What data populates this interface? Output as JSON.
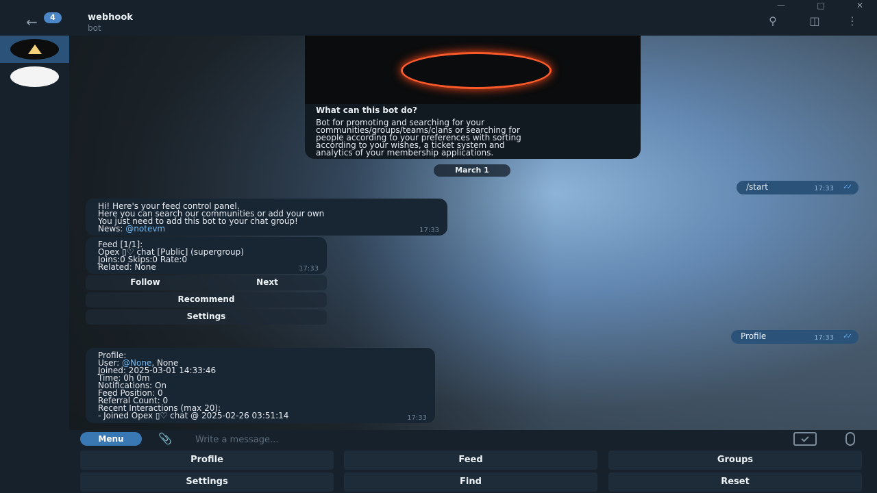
{
  "header": {
    "unread_badge": "4",
    "title": "webhook",
    "subtitle": "bot",
    "icons": [
      "back-arrow-icon",
      "search-icon",
      "sidebar-toggle-icon",
      "more-vertical-icon"
    ]
  },
  "bot_info": {
    "heading": "What can this bot do?",
    "description_lines": [
      "Bot for promoting and searching for your",
      "communities/groups/teams/clans or searching for",
      "people according to your preferences with sorting",
      "according to your wishes, a ticket system and",
      "analytics of your membership applications."
    ]
  },
  "date_separator": "March 1",
  "messages": {
    "start": {
      "text": "/start",
      "time": "17:33"
    },
    "welcome": {
      "lines": [
        "Hi! Here's your feed control panel.",
        "Here you can search our communities or add your own",
        "You just need to add this bot to your chat group!"
      ],
      "news_prefix": "News: ",
      "news_link": "@notevm",
      "time": "17:33"
    },
    "feed": {
      "lines": [
        "Feed [1/1]:",
        "Opex ▯♡ chat [Public] (supergroup)",
        "Joins:0 Skips:0 Rate:0",
        "Related: None"
      ],
      "time": "17:33",
      "buttons": {
        "follow": "Follow",
        "next": "Next",
        "recommend": "Recommend",
        "settings": "Settings"
      }
    },
    "profile_cmd": {
      "text": "Profile",
      "time": "17:33"
    },
    "profile": {
      "line1": "Profile:",
      "user_prefix": "User: ",
      "user_link": "@None",
      "user_suffix": ", None",
      "lines": [
        "Joined: 2025-03-01 14:33:46",
        "Time: 0h 0m",
        "Notifications: On",
        "Feed Position: 0",
        "Referral Count: 0",
        "Recent Interactions (max 20):",
        "- Joined Opex ▯♡ chat @ 2025-02-26 03:51:14"
      ],
      "time": "17:33"
    }
  },
  "composer": {
    "menu_label": "Menu",
    "placeholder": "Write a message..."
  },
  "reply_keyboard": {
    "row1": [
      "Profile",
      "Feed",
      "Groups"
    ],
    "row2": [
      "Settings",
      "Find",
      "Reset"
    ]
  }
}
